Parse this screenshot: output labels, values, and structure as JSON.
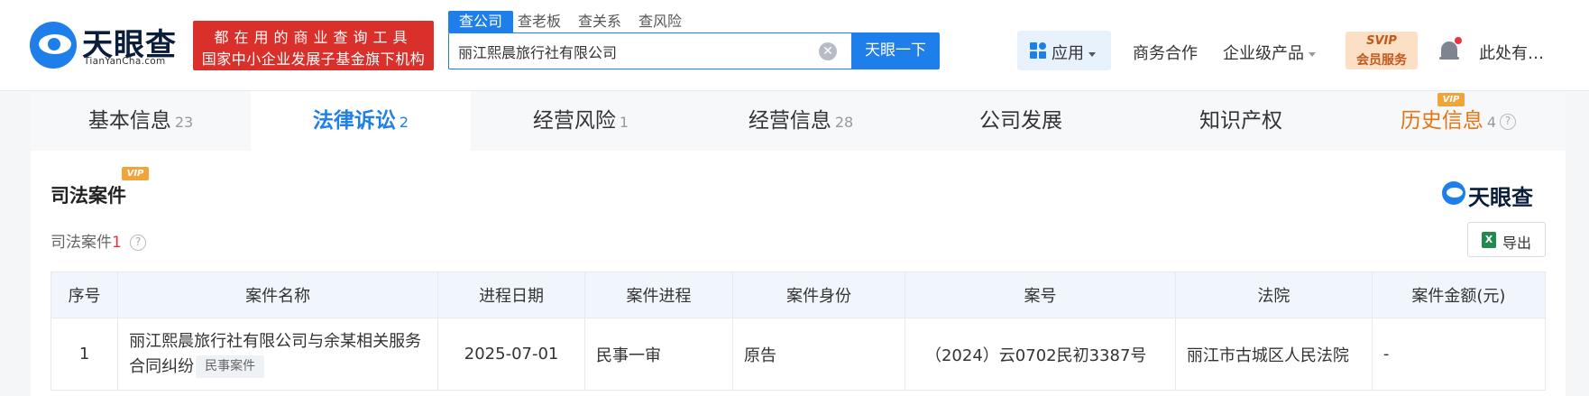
{
  "header": {
    "logo_title": "天眼查",
    "logo_subtitle": "TianYanCha.com",
    "slogan_line1": "都在用的商业查询工具",
    "slogan_line2": "国家中小企业发展子基金旗下机构",
    "search_tabs": [
      "查公司",
      "查老板",
      "查关系",
      "查风险"
    ],
    "search_value": "丽江熙晨旅行社有限公司",
    "clear_glyph": "✕",
    "search_button": "天眼一下",
    "app_label": "应用",
    "nav_business": "商务合作",
    "nav_enterprise": "企业级产品",
    "vip_top": "SVIP",
    "vip_bottom": "会员服务",
    "user_name": "此处有…"
  },
  "tabs": [
    {
      "label": "基本信息",
      "count": "23"
    },
    {
      "label": "法律诉讼",
      "count": "2"
    },
    {
      "label": "经营风险",
      "count": "1"
    },
    {
      "label": "经营信息",
      "count": "28"
    },
    {
      "label": "公司发展",
      "count": ""
    },
    {
      "label": "知识产权",
      "count": ""
    },
    {
      "label": "历史信息",
      "count": "4"
    }
  ],
  "tab_vip": "VIP",
  "section": {
    "title": "司法案件",
    "vip": "VIP",
    "brand": "天眼查",
    "count_label": "司法案件",
    "count_value": "1",
    "help_glyph": "?",
    "export_label": "导出",
    "excel_glyph": "X"
  },
  "table": {
    "headers": [
      "序号",
      "案件名称",
      "进程日期",
      "案件进程",
      "案件身份",
      "案号",
      "法院",
      "案件金额(元)"
    ],
    "rows": [
      {
        "index": "1",
        "name": "丽江熙晨旅行社有限公司与余某相关服务合同纠纷",
        "tag": "民事案件",
        "date": "2025-07-01",
        "stage": "民事一审",
        "role": "原告",
        "case_no": "（2024）云0702民初3387号",
        "court": "丽江市古城区人民法院",
        "amount": "-"
      }
    ]
  }
}
